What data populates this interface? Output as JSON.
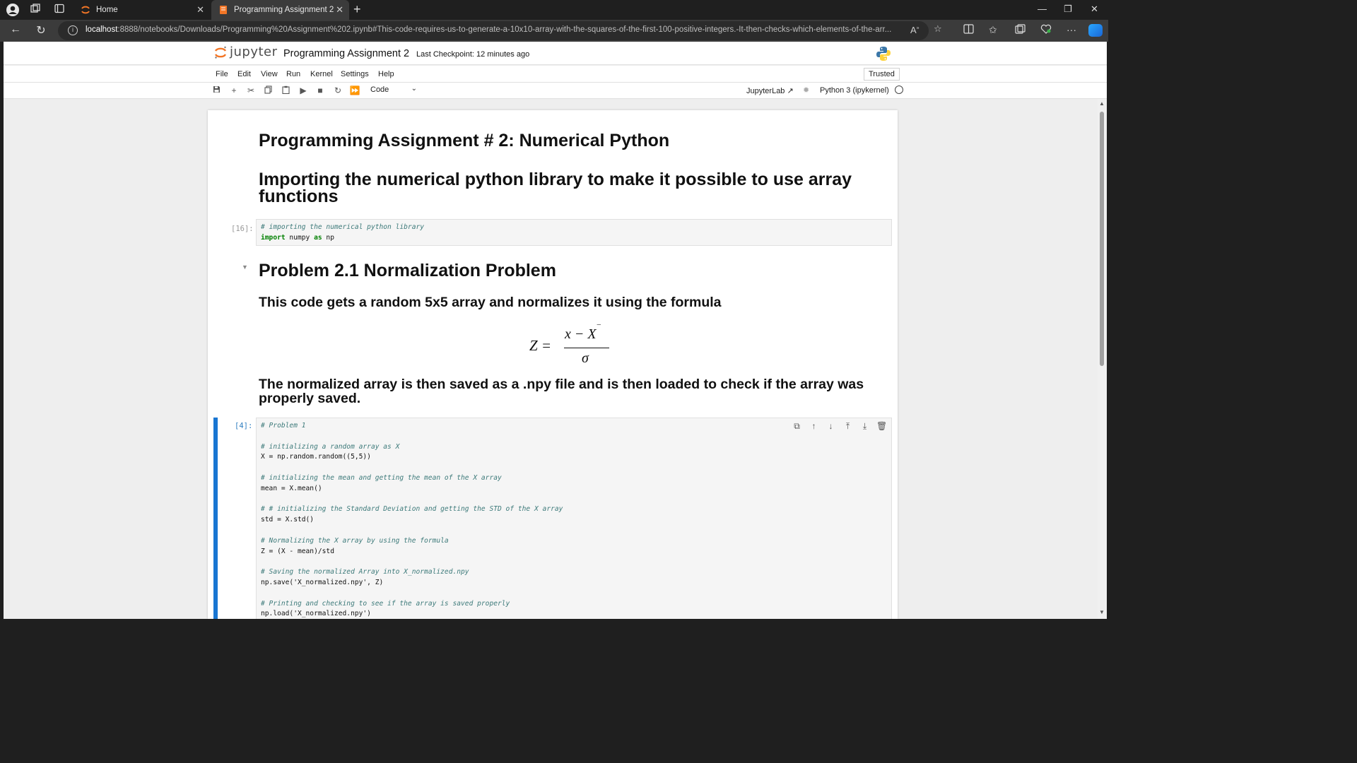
{
  "browser": {
    "tabs": [
      {
        "title": "Home"
      },
      {
        "title": "Programming Assignment 2"
      }
    ],
    "url_host": "localhost",
    "url_rest": ":8888/notebooks/Downloads/Programming%20Assignment%202.ipynb#This-code-requires-us-to-generate-a-10x10-array-with-the-squares-of-the-first-100-positive-integers.-It-then-checks-which-elements-of-the-arr..."
  },
  "jupyter": {
    "logo_text": "jupyter",
    "notebook_title": "Programming Assignment 2",
    "checkpoint": "Last Checkpoint: 12 minutes ago",
    "menu": [
      "File",
      "Edit",
      "View",
      "Run",
      "Kernel",
      "Settings",
      "Help"
    ],
    "trusted": "Trusted",
    "cell_type": "Code",
    "jupyterlab_link": "JupyterLab",
    "kernel_name": "Python 3 (ipykernel)"
  },
  "notebook": {
    "heading1": "Programming Assignment # 2: Numerical Python",
    "heading2": "Importing the numerical python library to make it possible to use array functions",
    "cell1_prompt": "[16]:",
    "cell1_lines": [
      "# importing the numerical python library",
      "import numpy as np"
    ],
    "heading3": "Problem 2.1 Normalization Problem",
    "heading4": "This code gets a random 5x5 array and normalizes it using the formula",
    "formula": {
      "lhs": "Z =",
      "numerator": "x − X",
      "denominator": "σ"
    },
    "heading5": "The normalized array is then saved as a .npy file and is then loaded to check if the array was properly saved.",
    "cell2_prompt": "[4]:",
    "cell2_lines": [
      "# Problem 1",
      "",
      "# initializing a random array as X",
      "X = np.random.random((5,5))",
      "",
      "# initializing the mean and getting the mean of the X array",
      "mean = X.mean()",
      "",
      "# # initializing the Standard Deviation and getting the STD of the X array",
      "std = X.std()",
      "",
      "# Normalizing the X array by using the formula",
      "Z = (X - mean)/std",
      "",
      "# Saving the normalized Array into X_normalized.npy",
      "np.save('X_normalized.npy', Z)",
      "",
      "# Printing and checking to see if the array is saved properly",
      "np.load('X_normalized.npy')"
    ]
  }
}
